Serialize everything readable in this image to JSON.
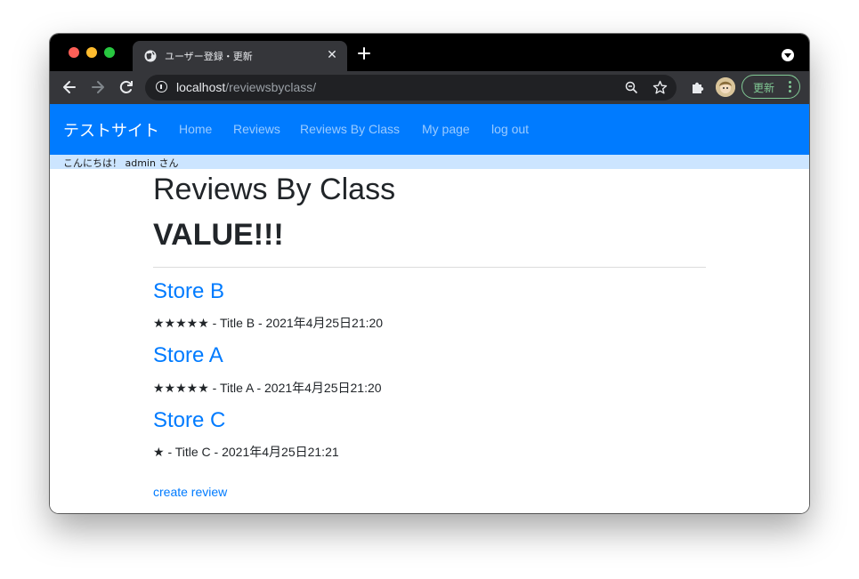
{
  "browser": {
    "tab_title": "ユーザー登録・更新",
    "tab_close": "✕",
    "url_host": "localhost",
    "url_path": "/reviewsbyclass/",
    "update_label": "更新"
  },
  "navbar": {
    "brand": "テストサイト",
    "links": [
      "Home",
      "Reviews",
      "Reviews By Class",
      "My page",
      "log out"
    ]
  },
  "greeting": "こんにちは！ admin さん",
  "main": {
    "title": "Reviews By Class",
    "subtitle": "VALUE!!!",
    "reviews": [
      {
        "store": "Store B",
        "meta": "★★★★★ - Title B - 2021年4月25日21:20"
      },
      {
        "store": "Store A",
        "meta": "★★★★★ - Title A - 2021年4月25日21:20"
      },
      {
        "store": "Store C",
        "meta": "★ - Title C - 2021年4月25日21:21"
      }
    ],
    "create_link": "create review"
  },
  "colors": {
    "navbar": "#007bff",
    "greeting_bar": "#cce5ff",
    "link": "#007bff",
    "update_accent": "#81c995"
  }
}
